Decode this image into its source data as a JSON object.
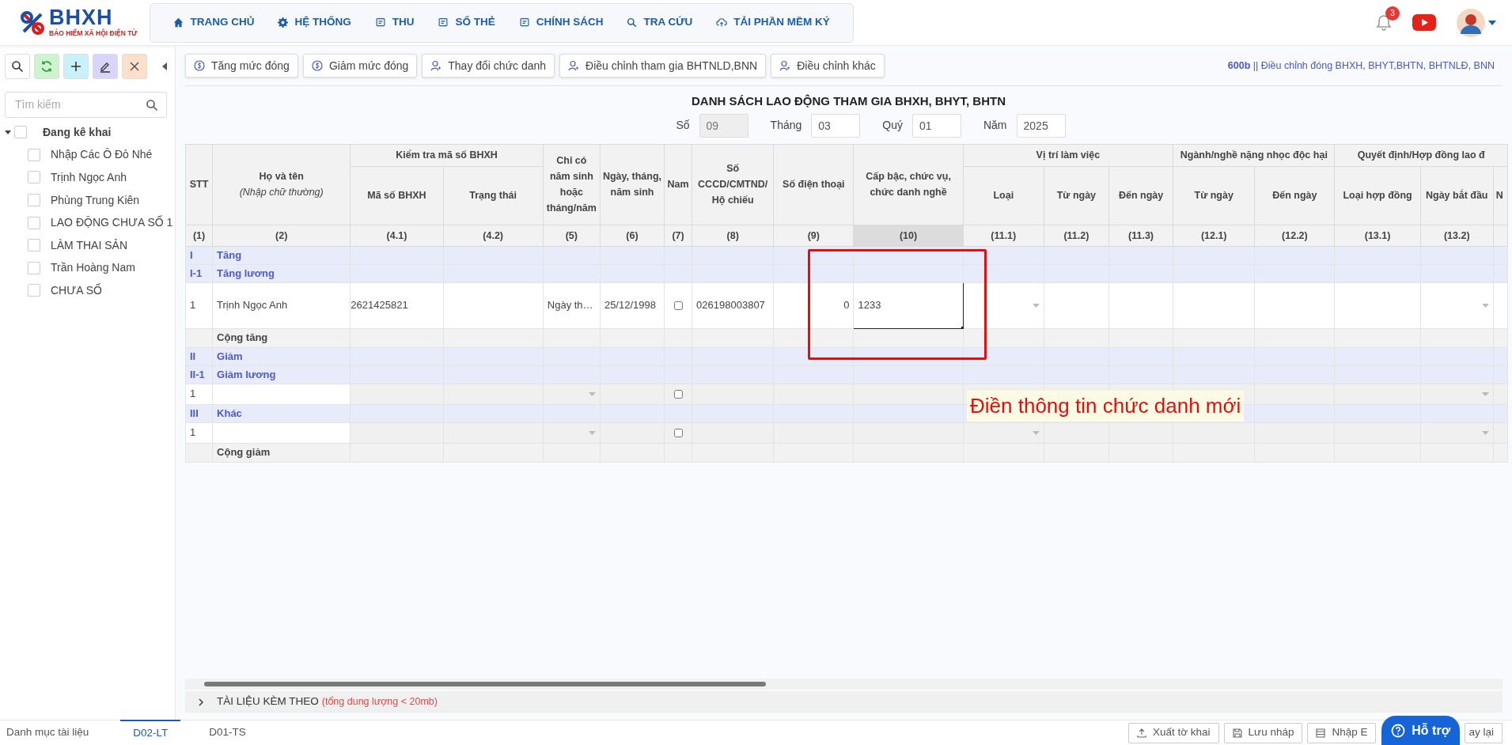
{
  "logo": {
    "text": "BHXH",
    "subtitle": "BẢO HIỂM XÃ HỘI ĐIỆN TỬ"
  },
  "nav": [
    {
      "label": "TRANG CHỦ"
    },
    {
      "label": "HỆ THỐNG"
    },
    {
      "label": "THU"
    },
    {
      "label": "SỐ THẺ"
    },
    {
      "label": "CHÍNH SÁCH"
    },
    {
      "label": "TRA CỨU"
    },
    {
      "label": "TẢI PHẦN MỀM KÝ"
    }
  ],
  "notifications": {
    "count": "3"
  },
  "sidebar": {
    "search": {
      "placeholder": "Tìm kiếm"
    },
    "tree": {
      "label": "Đang kê khai",
      "expanded": true,
      "checked": false,
      "children": [
        {
          "label": "Nhập Các Ô Đỏ Nhé",
          "checked": false
        },
        {
          "label": "Trịnh Ngọc Anh",
          "checked": false
        },
        {
          "label": "Phùng Trung Kiên",
          "checked": false
        },
        {
          "label": "LAO ĐỘNG CHƯA SỐ 1",
          "checked": false
        },
        {
          "label": "LÀM THAI SẢN",
          "checked": false
        },
        {
          "label": "Trần Hoàng Nam",
          "checked": false
        },
        {
          "label": "CHƯA SỐ",
          "checked": false
        }
      ]
    }
  },
  "actions": [
    {
      "label": "Tăng mức đóng",
      "kind": "money"
    },
    {
      "label": "Giảm mức đóng",
      "kind": "money"
    },
    {
      "label": "Thay đổi chức danh",
      "kind": "person"
    },
    {
      "label": "Điều chỉnh tham gia BHTNLD,BNN",
      "kind": "person"
    },
    {
      "label": "Điều chỉnh khác",
      "kind": "person"
    }
  ],
  "form_code": "**600b** || Điều chỉnh đóng BHXH, BHYT,BHTN, BHTNLĐ, BNN",
  "title": "DANH SÁCH LAO ĐỘNG THAM GIA BHXH, BHYT, BHTN",
  "period": [
    {
      "label": "Số",
      "value": "09",
      "disabled": true
    },
    {
      "label": "Tháng",
      "value": "03",
      "disabled": false
    },
    {
      "label": "Quý",
      "value": "01",
      "disabled": false
    },
    {
      "label": "Năm",
      "value": "2025",
      "disabled": false
    }
  ],
  "table": {
    "columns": [
      {
        "label": "STT",
        "number": "(1)",
        "selected": false
      },
      {
        "label": "Họ và tên",
        "note": "(Nhập chữ thường)",
        "number": "(2)",
        "selected": false
      },
      {
        "label": "Kiểm tra mã số BHXH",
        "children": [
          {
            "label": "Mã số BHXH",
            "number": "(4.1)",
            "selected": false
          },
          {
            "label": "Trạng thái",
            "number": "(4.2)",
            "selected": false
          }
        ]
      },
      {
        "label": "Chỉ có năm sinh hoặc tháng/năm",
        "number": "(5)",
        "selected": false
      },
      {
        "label": "Ngày, tháng, năm sinh",
        "number": "(6)",
        "selected": false
      },
      {
        "label": "Nam",
        "number": "(7)",
        "selected": false
      },
      {
        "label": "Số CCCD/CMTND/ Hộ chiếu",
        "number": "(8)",
        "selected": false
      },
      {
        "label": "Số điện thoại",
        "number": "(9)",
        "selected": false
      },
      {
        "label": "Cấp bậc, chức vụ, chức danh nghề",
        "number": "(10)",
        "selected": true
      },
      {
        "label": "Vị trí làm việc",
        "children": [
          {
            "label": "Loại",
            "number": "(11.1)",
            "selected": false
          },
          {
            "label": "Từ ngày",
            "number": "(11.2)",
            "selected": false
          },
          {
            "label": "Đến ngày",
            "number": "(11.3)",
            "selected": false
          }
        ]
      },
      {
        "label": "Ngành/nghề nặng nhọc độc hại",
        "children": [
          {
            "label": "Từ ngày",
            "number": "(12.1)",
            "selected": false
          },
          {
            "label": "Đến ngày",
            "number": "(12.2)",
            "selected": false
          }
        ]
      },
      {
        "label": "Quyết định/Hợp đồng lao đ",
        "children": [
          {
            "label": "Loại hợp đồng",
            "number": "(13.1)",
            "selected": false
          },
          {
            "label": "Ngày bắt đầu",
            "number": "(13.2)",
            "selected": false
          },
          {
            "label": "N",
            "selected": false
          }
        ]
      }
    ],
    "rows": [
      {
        "kind": "section",
        "code": "I",
        "label": "Tăng"
      },
      {
        "kind": "section",
        "code": "I-1",
        "label": "Tăng lương"
      },
      {
        "kind": "entry",
        "stt": "1",
        "name": "Trịnh Ngọc Anh",
        "bhxh_code": "2621425821",
        "birth_type": "Ngày th…",
        "birth_date": "25/12/1998",
        "male": false,
        "id_number": "026198003807",
        "phone": "0",
        "job_title": "1233",
        "job_title_editing": true,
        "disabled": false
      },
      {
        "kind": "total",
        "label": "Cộng tăng"
      },
      {
        "kind": "section",
        "code": "II",
        "label": "Giảm"
      },
      {
        "kind": "section",
        "code": "II-1",
        "label": "Giảm lương"
      },
      {
        "kind": "entry",
        "stt": "1",
        "male": false,
        "job_title_editing": false,
        "disabled": true
      },
      {
        "kind": "section",
        "code": "III",
        "label": "Khác"
      },
      {
        "kind": "entry",
        "stt": "1",
        "male": false,
        "job_title_editing": false,
        "disabled": true
      },
      {
        "kind": "total",
        "label": "Cộng giảm"
      }
    ]
  },
  "annotation": {
    "text": "Điền thông tin chức danh mới"
  },
  "attachments": {
    "label": "TÀI LIỆU KÈM THEO",
    "note": "(tổng dung lượng < 20mb)",
    "expanded": false
  },
  "bottom": {
    "label": "Danh mục tài liệu",
    "tabs": [
      {
        "label": "D02-LT",
        "selected": true
      },
      {
        "label": "D01-TS",
        "selected": false
      }
    ],
    "buttons": [
      {
        "label": "Xuất tờ khai"
      },
      {
        "label": "Lưu nháp"
      },
      {
        "label": "Nhập E"
      },
      {
        "label": "ay lại"
      }
    ],
    "help": "Hỗ trợ"
  }
}
